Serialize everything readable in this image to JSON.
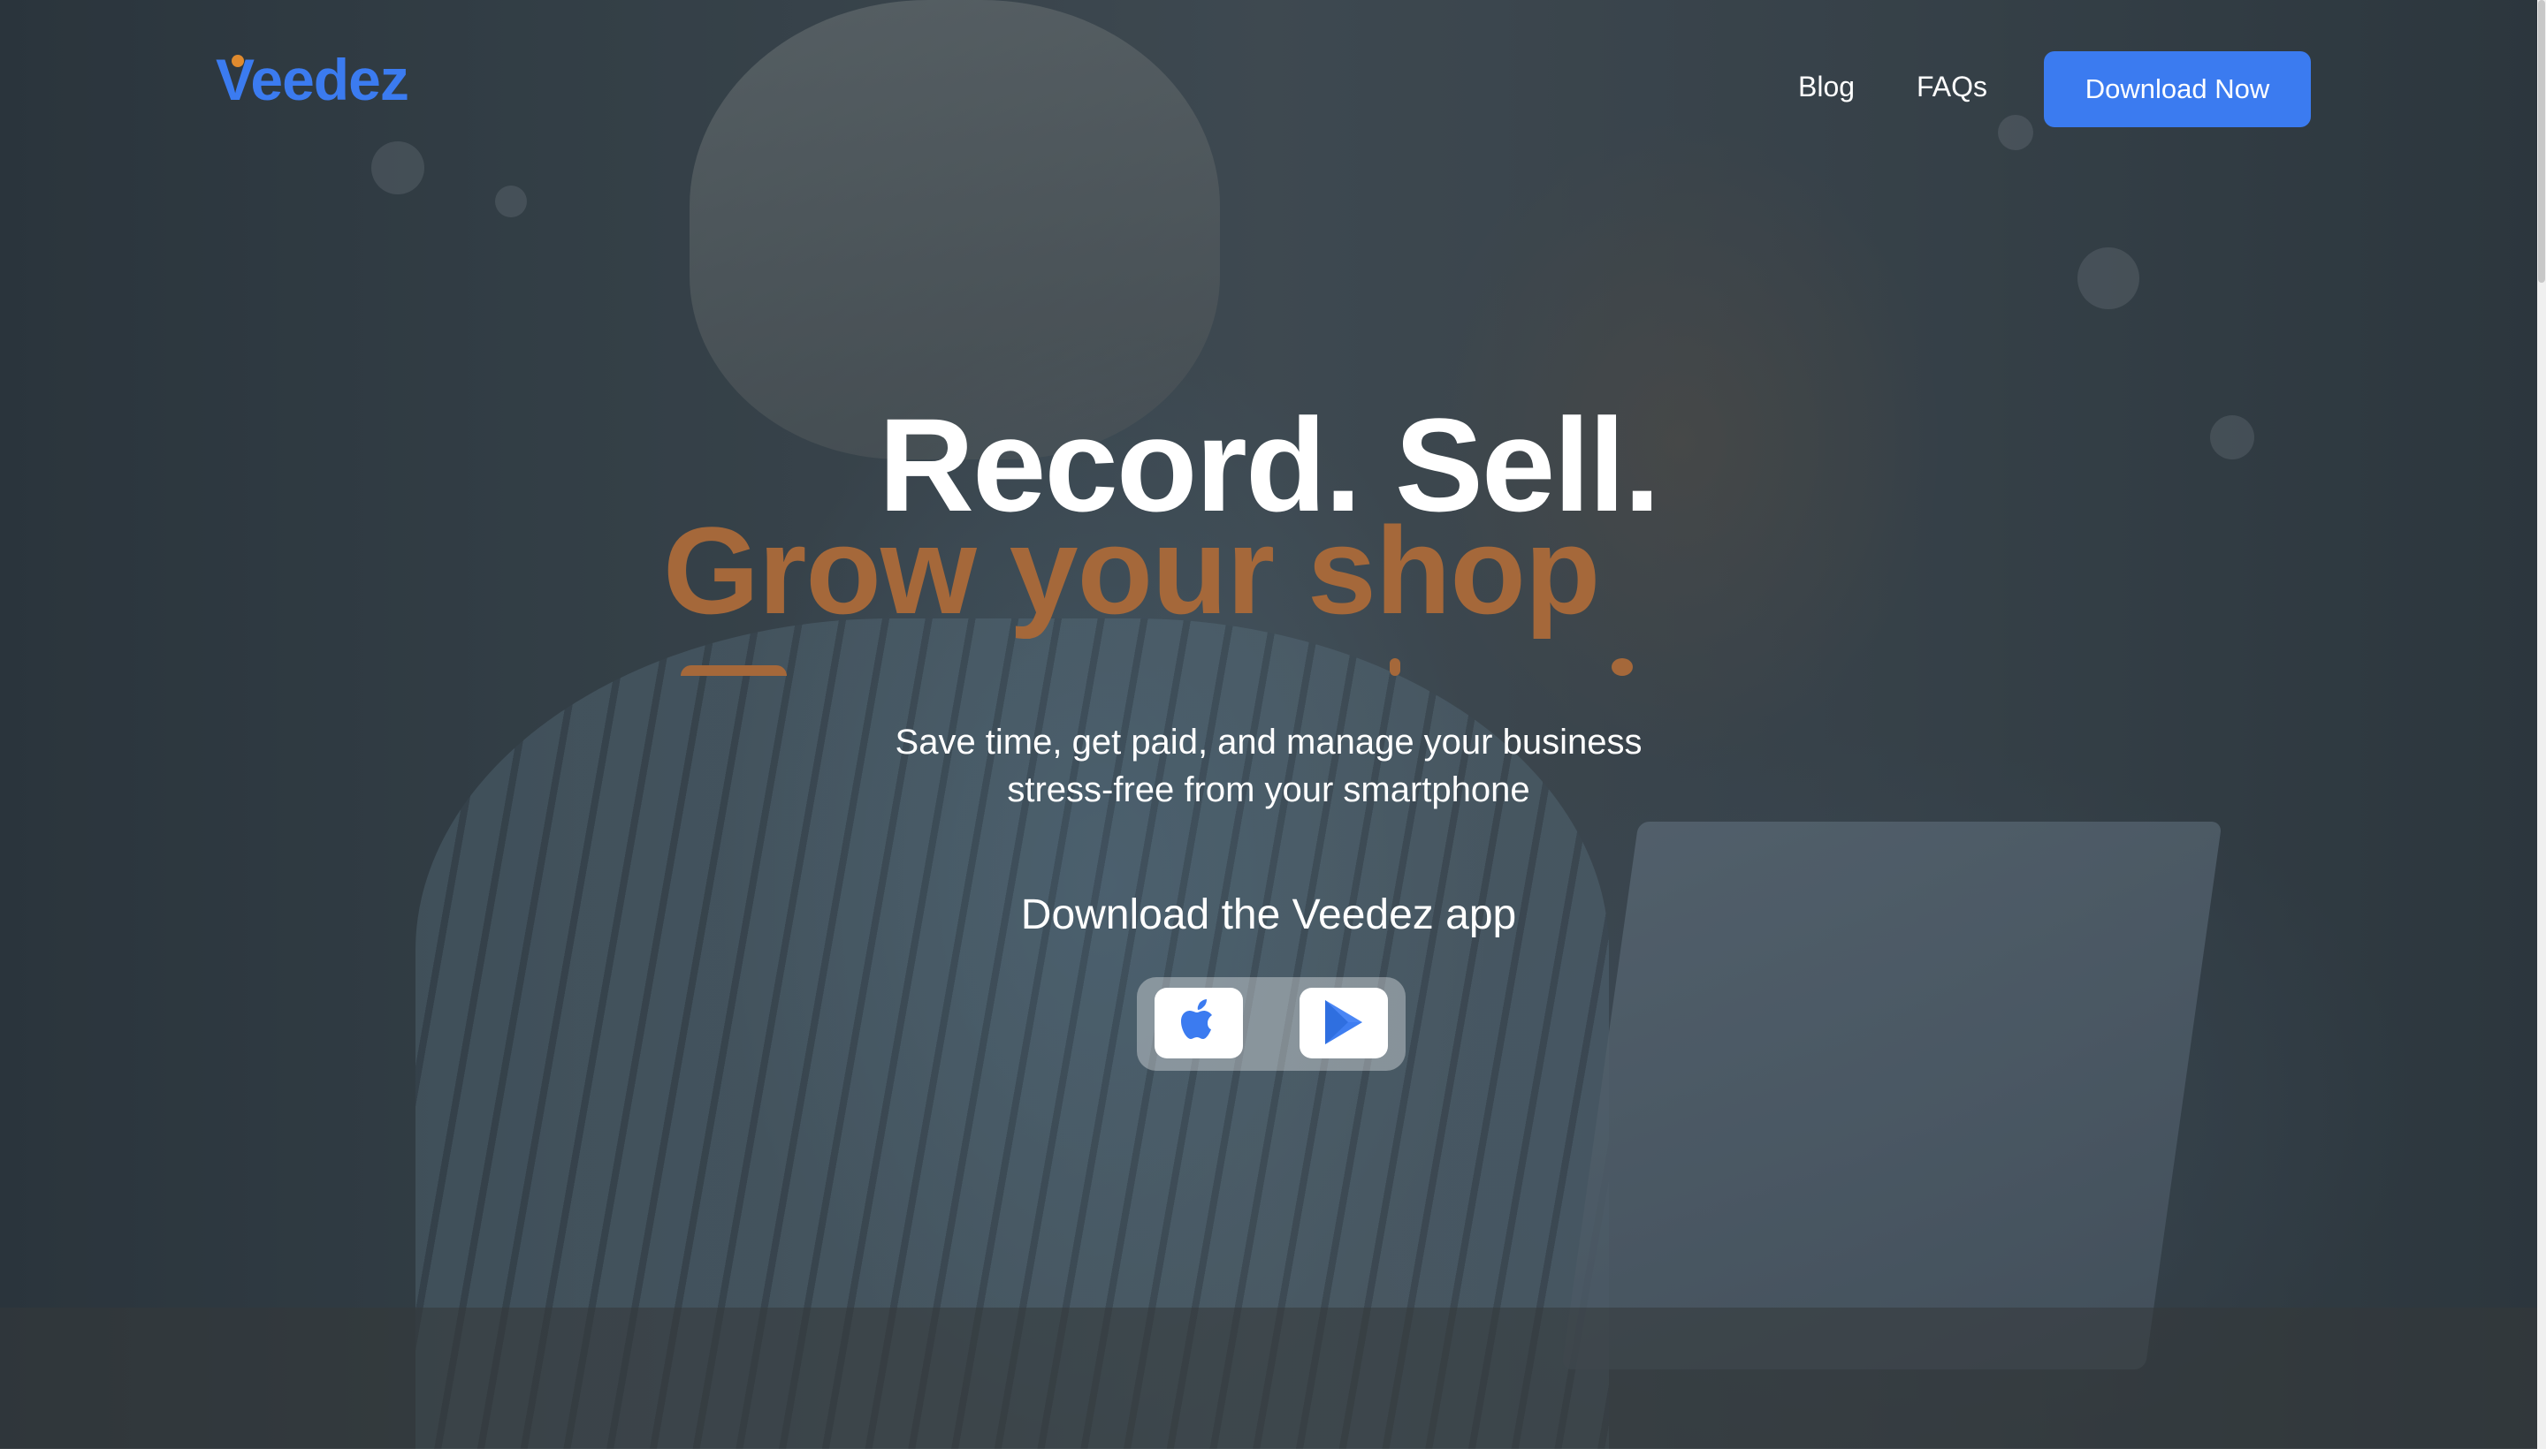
{
  "header": {
    "logo_text": "Veedez",
    "nav": [
      {
        "label": "Blog"
      },
      {
        "label": "FAQs"
      }
    ],
    "cta_label": "Download Now"
  },
  "hero": {
    "headline": "Record. Sell.",
    "rotating_text": "Grow your shop",
    "subtitle_line1": "Save time, get paid, and manage your business",
    "subtitle_line2": "stress-free from your smartphone",
    "download_label": "Download the Veedez app",
    "stores": [
      {
        "name": "apple-app-store",
        "icon": "apple-icon"
      },
      {
        "name": "google-play-store",
        "icon": "play-store-icon"
      }
    ]
  },
  "colors": {
    "brand_blue": "#3b7bf0",
    "accent_orange": "#e08a2e",
    "rotating_text": "#a5683a"
  }
}
